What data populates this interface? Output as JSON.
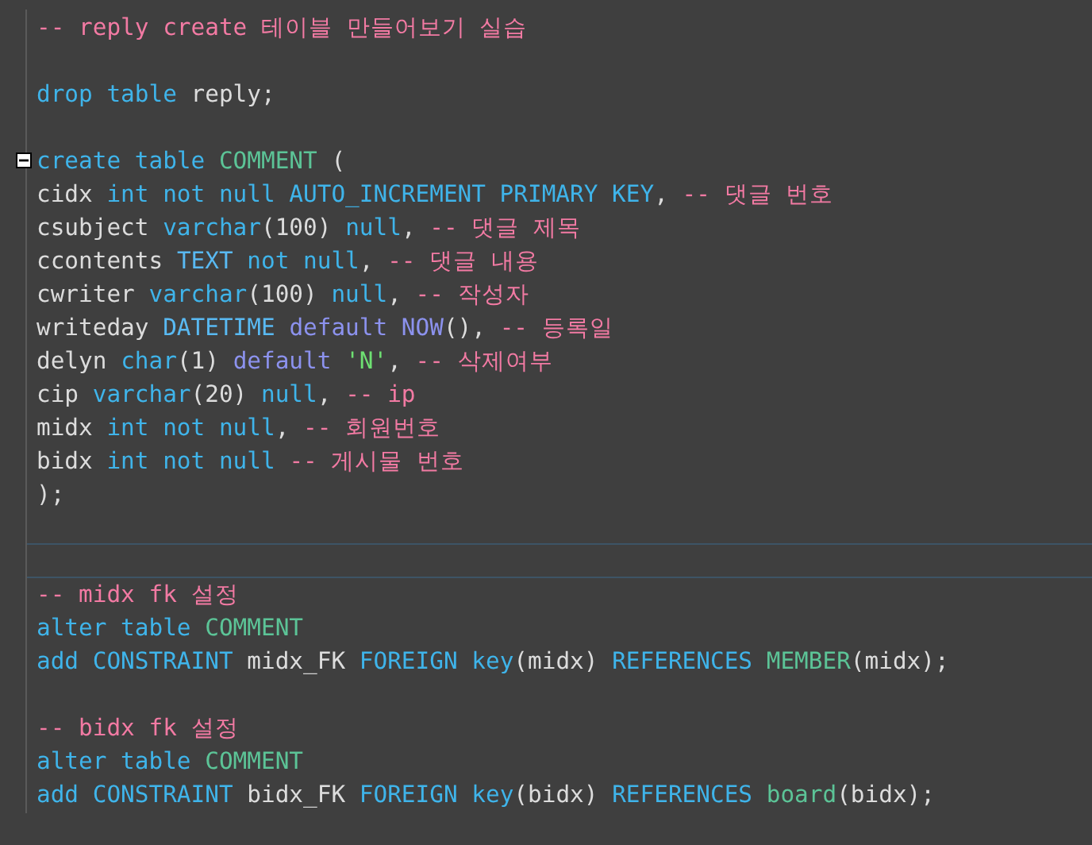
{
  "editor": {
    "lines": [
      {
        "tokens": [
          {
            "text": "-- reply create 테이블 만들어보기 실습",
            "kind": "comment"
          }
        ]
      },
      {
        "blank": true
      },
      {
        "tokens": [
          {
            "text": "drop table ",
            "kind": "keyword"
          },
          {
            "text": "reply;",
            "kind": "plain"
          }
        ]
      },
      {
        "blank": true
      },
      {
        "expanded": true,
        "tokens": [
          {
            "text": "create table ",
            "kind": "keyword"
          },
          {
            "text": "COMMENT",
            "kind": "table"
          },
          {
            "text": " (",
            "kind": "plain"
          }
        ]
      },
      {
        "tokens": [
          {
            "text": "cidx ",
            "kind": "plain"
          },
          {
            "text": "int not null AUTO_INCREMENT PRIMARY KEY",
            "kind": "keyword"
          },
          {
            "text": ", ",
            "kind": "plain"
          },
          {
            "text": "-- 댓글 번호",
            "kind": "comment"
          }
        ]
      },
      {
        "tokens": [
          {
            "text": "csubject ",
            "kind": "plain"
          },
          {
            "text": "varchar",
            "kind": "keyword"
          },
          {
            "text": "(100) ",
            "kind": "plain"
          },
          {
            "text": "null",
            "kind": "keyword"
          },
          {
            "text": ", ",
            "kind": "plain"
          },
          {
            "text": "-- 댓글 제목",
            "kind": "comment"
          }
        ]
      },
      {
        "tokens": [
          {
            "text": "ccontents ",
            "kind": "plain"
          },
          {
            "text": "TEXT ",
            "kind": "type"
          },
          {
            "text": "not null",
            "kind": "keyword"
          },
          {
            "text": ", ",
            "kind": "plain"
          },
          {
            "text": "-- 댓글 내용",
            "kind": "comment"
          }
        ]
      },
      {
        "tokens": [
          {
            "text": "cwriter ",
            "kind": "plain"
          },
          {
            "text": "varchar",
            "kind": "keyword"
          },
          {
            "text": "(100) ",
            "kind": "plain"
          },
          {
            "text": "null",
            "kind": "keyword"
          },
          {
            "text": ", ",
            "kind": "plain"
          },
          {
            "text": "-- 작성자",
            "kind": "comment"
          }
        ]
      },
      {
        "tokens": [
          {
            "text": "writeday ",
            "kind": "plain"
          },
          {
            "text": "DATETIME ",
            "kind": "type"
          },
          {
            "text": "default NOW",
            "kind": "function"
          },
          {
            "text": "(), ",
            "kind": "plain"
          },
          {
            "text": "-- 등록일",
            "kind": "comment"
          }
        ]
      },
      {
        "tokens": [
          {
            "text": "delyn ",
            "kind": "plain"
          },
          {
            "text": "char",
            "kind": "keyword"
          },
          {
            "text": "(1) ",
            "kind": "plain"
          },
          {
            "text": "default ",
            "kind": "function"
          },
          {
            "text": "'N'",
            "kind": "string"
          },
          {
            "text": ", ",
            "kind": "plain"
          },
          {
            "text": "-- 삭제여부",
            "kind": "comment"
          }
        ]
      },
      {
        "tokens": [
          {
            "text": "cip ",
            "kind": "plain"
          },
          {
            "text": "varchar",
            "kind": "keyword"
          },
          {
            "text": "(20) ",
            "kind": "plain"
          },
          {
            "text": "null",
            "kind": "keyword"
          },
          {
            "text": ", ",
            "kind": "plain"
          },
          {
            "text": "-- ip",
            "kind": "comment"
          }
        ]
      },
      {
        "tokens": [
          {
            "text": "midx ",
            "kind": "plain"
          },
          {
            "text": "int not null",
            "kind": "keyword"
          },
          {
            "text": ", ",
            "kind": "plain"
          },
          {
            "text": "-- 회원번호",
            "kind": "comment"
          }
        ]
      },
      {
        "tokens": [
          {
            "text": "bidx ",
            "kind": "plain"
          },
          {
            "text": "int not null ",
            "kind": "keyword"
          },
          {
            "text": "-- 게시물 번호",
            "kind": "comment"
          }
        ]
      },
      {
        "tokens": [
          {
            "text": ");",
            "kind": "plain"
          }
        ]
      },
      {
        "blank": true,
        "rule_below": true
      },
      {
        "blank": true,
        "rule_below": true
      },
      {
        "tokens": [
          {
            "text": "-- midx fk 설정",
            "kind": "comment"
          }
        ]
      },
      {
        "tokens": [
          {
            "text": "alter table ",
            "kind": "keyword"
          },
          {
            "text": "COMMENT",
            "kind": "table"
          }
        ]
      },
      {
        "tokens": [
          {
            "text": "add CONSTRAINT ",
            "kind": "keyword"
          },
          {
            "text": "midx_FK ",
            "kind": "plain"
          },
          {
            "text": "FOREIGN key",
            "kind": "keyword"
          },
          {
            "text": "(midx) ",
            "kind": "plain"
          },
          {
            "text": "REFERENCES ",
            "kind": "keyword"
          },
          {
            "text": "MEMBER",
            "kind": "table"
          },
          {
            "text": "(midx);",
            "kind": "plain"
          }
        ]
      },
      {
        "blank": true
      },
      {
        "tokens": [
          {
            "text": "-- bidx fk 설정",
            "kind": "comment"
          }
        ]
      },
      {
        "tokens": [
          {
            "text": "alter table ",
            "kind": "keyword"
          },
          {
            "text": "COMMENT",
            "kind": "table"
          }
        ]
      },
      {
        "tokens": [
          {
            "text": "add CONSTRAINT ",
            "kind": "keyword"
          },
          {
            "text": "bidx_FK ",
            "kind": "plain"
          },
          {
            "text": "FOREIGN key",
            "kind": "keyword"
          },
          {
            "text": "(bidx) ",
            "kind": "plain"
          },
          {
            "text": "REFERENCES ",
            "kind": "keyword"
          },
          {
            "text": "board",
            "kind": "table"
          },
          {
            "text": "(bidx);",
            "kind": "plain"
          }
        ]
      }
    ]
  }
}
